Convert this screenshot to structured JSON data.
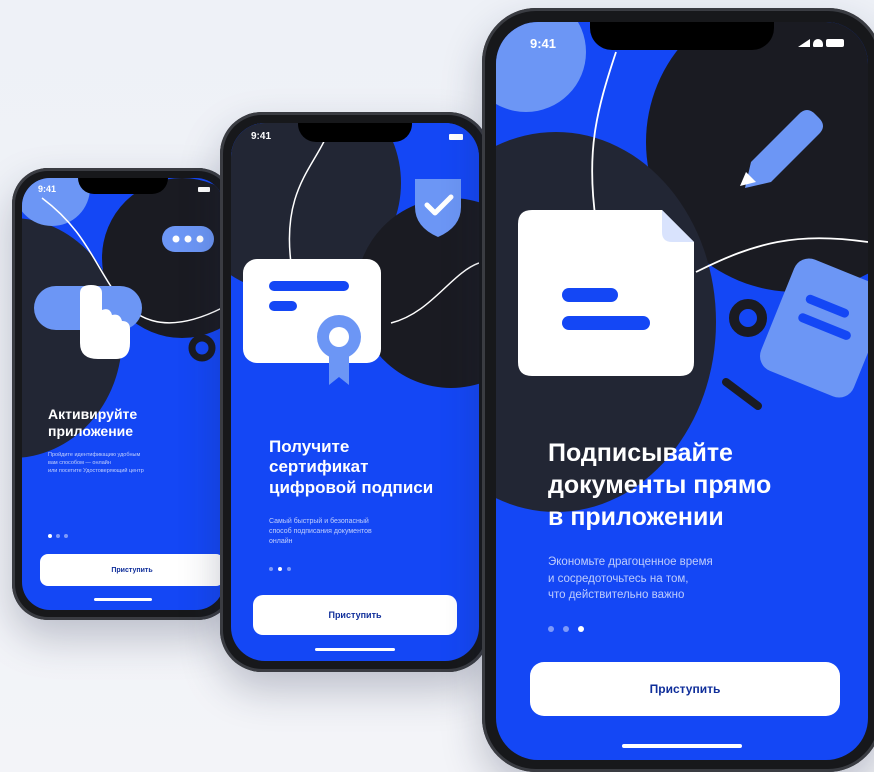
{
  "status_time": "9:41",
  "screens": [
    {
      "title": "Активируйте\nприложение",
      "subtitle": "Пройдите идентификацию удобным\nвам способом — онлайн\nили посетите Удостоверяющий центр",
      "button": "Приступить",
      "active_dot": 0
    },
    {
      "title": "Получите\nсертификат\nцифровой подписи",
      "subtitle": "Самый быстрый и безопасный\nспособ подписания документов\nонлайн",
      "button": "Приступить",
      "active_dot": 1
    },
    {
      "title": "Подписывайте\nдокументы прямо\nв приложении",
      "subtitle": "Экономьте драгоценное время\nи сосредоточьтесь на том,\nчто действительно важно",
      "button": "Приступить",
      "active_dot": 2
    }
  ],
  "colors": {
    "screen_blue": "#1447f5",
    "dark_shape": "#1a1b22",
    "light_blue": "#6c96f5",
    "white": "#ffffff"
  }
}
